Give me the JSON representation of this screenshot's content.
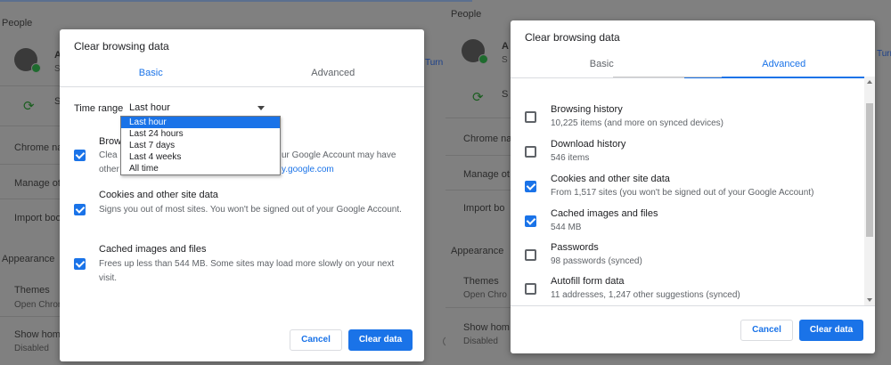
{
  "background": {
    "people_heading": "People",
    "appearance_heading": "Appearance",
    "left": {
      "account_name_partial": "A",
      "account_sub_partial": "S",
      "sync_partial": "S",
      "chrome_name": "Chrome na",
      "manage_other": "Manage ot",
      "import_book": "Import boo",
      "themes": "Themes",
      "themes_sub": "Open Chrom",
      "show_home": "Show home",
      "show_home_sub": "Disabled",
      "turn_on": "Turn o"
    },
    "right": {
      "account_name_partial": "A",
      "account_sub_partial": "S",
      "sync_partial": "S",
      "chrome_name": "Chrome na",
      "manage_other": "Manage ot",
      "import_book": "Import bo",
      "themes": "Themes",
      "themes_sub": "Open Chro",
      "show_home": "Show hom",
      "show_home_sub": "Disabled",
      "turn_on": "Turn o"
    }
  },
  "left_dialog": {
    "title": "Clear browsing data",
    "tabs": [
      {
        "label": "Basic",
        "active": true
      },
      {
        "label": "Advanced",
        "active": false
      }
    ],
    "time_range": {
      "label": "Time range",
      "value": "Last hour",
      "options": [
        "Last hour",
        "Last 24 hours",
        "Last 7 days",
        "Last 4 weeks",
        "All time"
      ]
    },
    "items": [
      {
        "title": "Brow",
        "sub_line1": "Clea",
        "sub_line1_right": "ur Google Account may have",
        "sub_line2": "other",
        "sub_link": "y.google.com",
        "checked": true
      },
      {
        "title": "Cookies and other site data",
        "sub": "Signs you out of most sites. You won't be signed out of your Google Account.",
        "checked": true
      },
      {
        "title": "Cached images and files",
        "sub": "Frees up less than 544 MB. Some sites may load more slowly on your next visit.",
        "checked": true
      }
    ],
    "cancel_label": "Cancel",
    "clear_label": "Clear data"
  },
  "right_dialog": {
    "title": "Clear browsing data",
    "tabs": [
      {
        "label": "Basic",
        "active": false
      },
      {
        "label": "Advanced",
        "active": true
      }
    ],
    "items": [
      {
        "title": "Browsing history",
        "sub": "10,225 items (and more on synced devices)",
        "checked": false
      },
      {
        "title": "Download history",
        "sub": "546 items",
        "checked": false
      },
      {
        "title": "Cookies and other site data",
        "sub": "From 1,517 sites (you won't be signed out of your Google Account)",
        "checked": true
      },
      {
        "title": "Cached images and files",
        "sub": "544 MB",
        "checked": true
      },
      {
        "title": "Passwords",
        "sub": "98 passwords (synced)",
        "checked": false
      },
      {
        "title": "Autofill form data",
        "sub": "11 addresses, 1,247 other suggestions (synced)",
        "checked": false
      }
    ],
    "cancel_label": "Cancel",
    "clear_label": "Clear data"
  },
  "colors": {
    "accent": "#1a73e8",
    "overlay": "#808080"
  }
}
